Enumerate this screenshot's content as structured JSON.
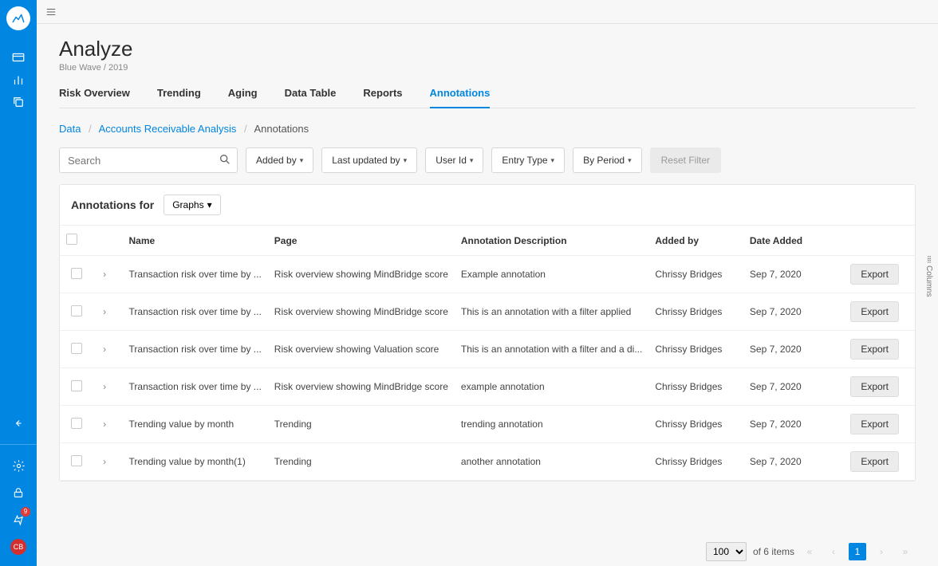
{
  "sidebar": {
    "notification_count": "9",
    "avatar_initials": "CB"
  },
  "header": {
    "title": "Analyze",
    "subtitle": "Blue Wave / 2019"
  },
  "tabs": [
    {
      "label": "Risk Overview",
      "active": false
    },
    {
      "label": "Trending",
      "active": false
    },
    {
      "label": "Aging",
      "active": false
    },
    {
      "label": "Data Table",
      "active": false
    },
    {
      "label": "Reports",
      "active": false
    },
    {
      "label": "Annotations",
      "active": true
    }
  ],
  "breadcrumb": {
    "items": [
      "Data",
      "Accounts Receivable Analysis"
    ],
    "current": "Annotations"
  },
  "search": {
    "placeholder": "Search"
  },
  "filters": {
    "added_by": "Added by",
    "last_updated_by": "Last updated by",
    "user_id": "User Id",
    "entry_type": "Entry Type",
    "by_period": "By Period",
    "reset": "Reset Filter"
  },
  "panel": {
    "heading": "Annotations for",
    "selector_label": "Graphs"
  },
  "columns": {
    "name": "Name",
    "page": "Page",
    "desc": "Annotation Description",
    "added_by": "Added by",
    "date": "Date Added"
  },
  "rows": [
    {
      "name": "Transaction risk over time by ...",
      "page": "Risk overview showing MindBridge score",
      "desc": "Example annotation",
      "added_by": "Chrissy Bridges",
      "date": "Sep 7, 2020"
    },
    {
      "name": "Transaction risk over time by ...",
      "page": "Risk overview showing MindBridge score",
      "desc": "This is an annotation with a filter applied",
      "added_by": "Chrissy Bridges",
      "date": "Sep 7, 2020"
    },
    {
      "name": "Transaction risk over time by ...",
      "page": "Risk overview showing Valuation score",
      "desc": "This is an annotation with a filter and a di...",
      "added_by": "Chrissy Bridges",
      "date": "Sep 7, 2020"
    },
    {
      "name": "Transaction risk over time by ...",
      "page": "Risk overview showing MindBridge score",
      "desc": "example annotation",
      "added_by": "Chrissy Bridges",
      "date": "Sep 7, 2020"
    },
    {
      "name": "Trending value by month",
      "page": "Trending",
      "desc": "trending annotation",
      "added_by": "Chrissy Bridges",
      "date": "Sep 7, 2020"
    },
    {
      "name": "Trending value by month(1)",
      "page": "Trending",
      "desc": "another annotation",
      "added_by": "Chrissy Bridges",
      "date": "Sep 7, 2020"
    }
  ],
  "export_label": "Export",
  "columns_label": "Columns",
  "pagination": {
    "page_size": "100",
    "total_text": "of 6 items",
    "current": "1"
  }
}
